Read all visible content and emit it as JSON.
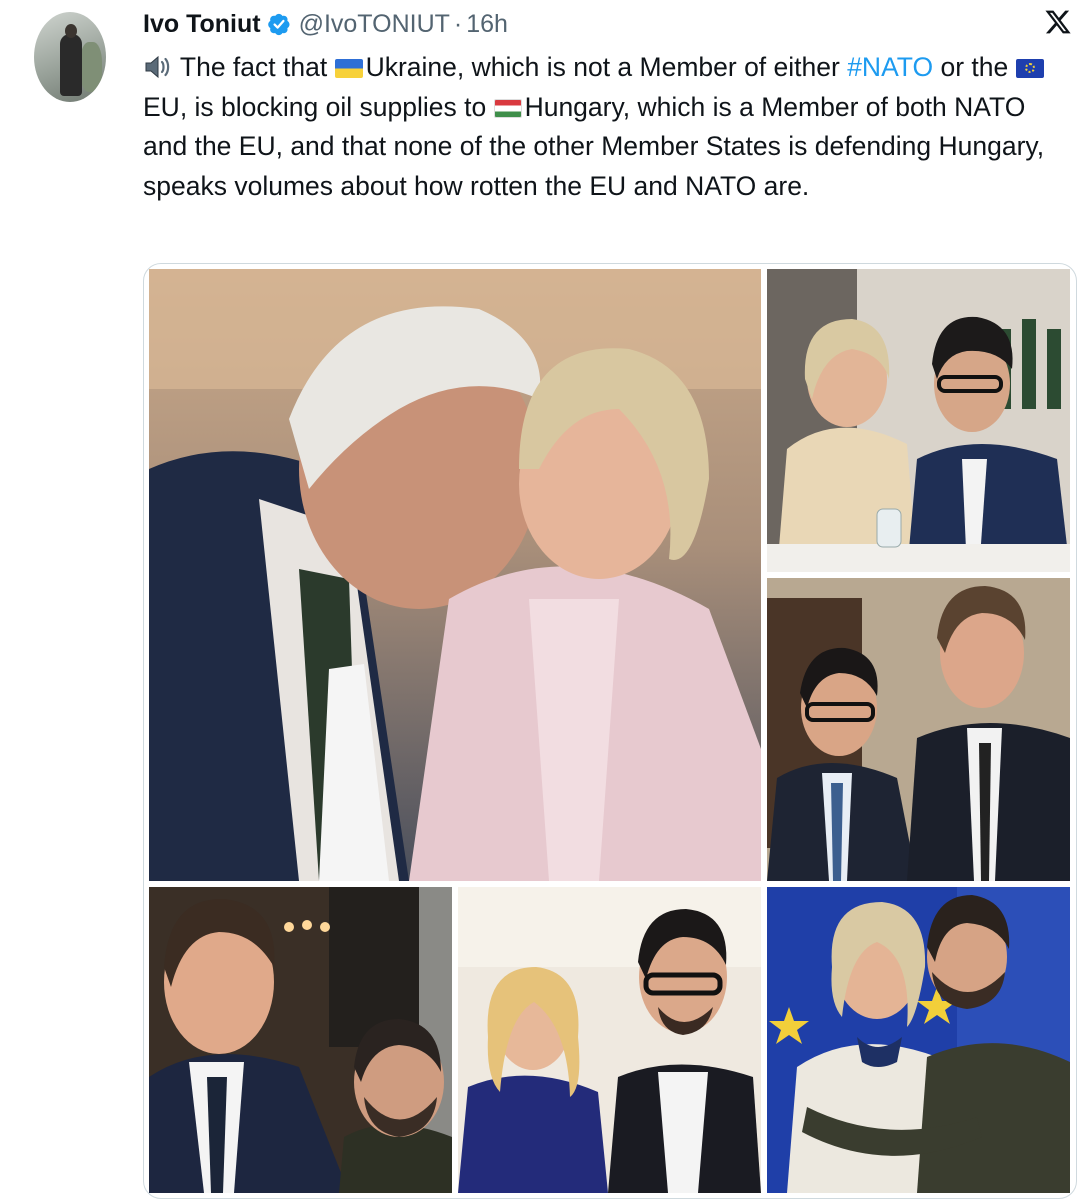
{
  "author": {
    "display_name": "Ivo Toniut",
    "handle": "@IvoTONIUT",
    "separator": "·",
    "time": "16h"
  },
  "icons": {
    "verified": "verified-badge-icon",
    "platform_logo": "x-logo-icon",
    "speaker": "speaker-icon",
    "flag_ukraine": "ukraine-flag-icon",
    "flag_eu": "eu-flag-icon",
    "flag_hungary": "hungary-flag-icon"
  },
  "colors": {
    "text": "#0f1419",
    "secondary": "#536471",
    "link": "#1d9bf0",
    "verified": "#1d9bf0",
    "border": "#cfd9de"
  },
  "tweet": {
    "seg1": "The fact that ",
    "seg2": "Ukraine, which is not a Member of either ",
    "hashtag": "#NATO",
    "seg3": " or the ",
    "seg4": "EU, is blocking oil supplies to ",
    "seg5": "Hungary, which is a Member of both NATO and the EU, and that none of the other Member States is defending Hungary, speaks volumes about how rotten the EU and NATO are."
  },
  "media": {
    "photo_count": 6
  }
}
